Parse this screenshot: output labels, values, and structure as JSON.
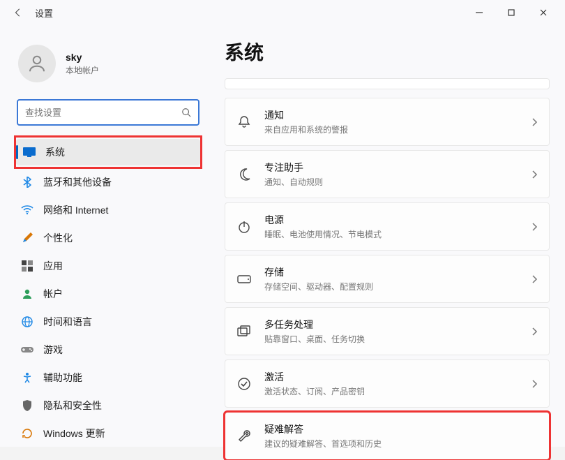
{
  "titlebar": {
    "title": "设置"
  },
  "user": {
    "name": "sky",
    "subtitle": "本地帐户"
  },
  "search": {
    "placeholder": "查找设置"
  },
  "nav": {
    "items": [
      {
        "label": "系统"
      },
      {
        "label": "蓝牙和其他设备"
      },
      {
        "label": "网络和 Internet"
      },
      {
        "label": "个性化"
      },
      {
        "label": "应用"
      },
      {
        "label": "帐户"
      },
      {
        "label": "时间和语言"
      },
      {
        "label": "游戏"
      },
      {
        "label": "辅助功能"
      },
      {
        "label": "隐私和安全性"
      },
      {
        "label": "Windows 更新"
      }
    ]
  },
  "main": {
    "title": "系统",
    "cards": [
      {
        "title": "通知",
        "subtitle": "来自应用和系统的警报"
      },
      {
        "title": "专注助手",
        "subtitle": "通知、自动规则"
      },
      {
        "title": "电源",
        "subtitle": "睡眠、电池使用情况、节电模式"
      },
      {
        "title": "存储",
        "subtitle": "存储空间、驱动器、配置规则"
      },
      {
        "title": "多任务处理",
        "subtitle": "贴靠窗口、桌面、任务切换"
      },
      {
        "title": "激活",
        "subtitle": "激活状态、订阅、产品密钥"
      },
      {
        "title": "疑难解答",
        "subtitle": "建议的疑难解答、首选项和历史"
      }
    ]
  }
}
